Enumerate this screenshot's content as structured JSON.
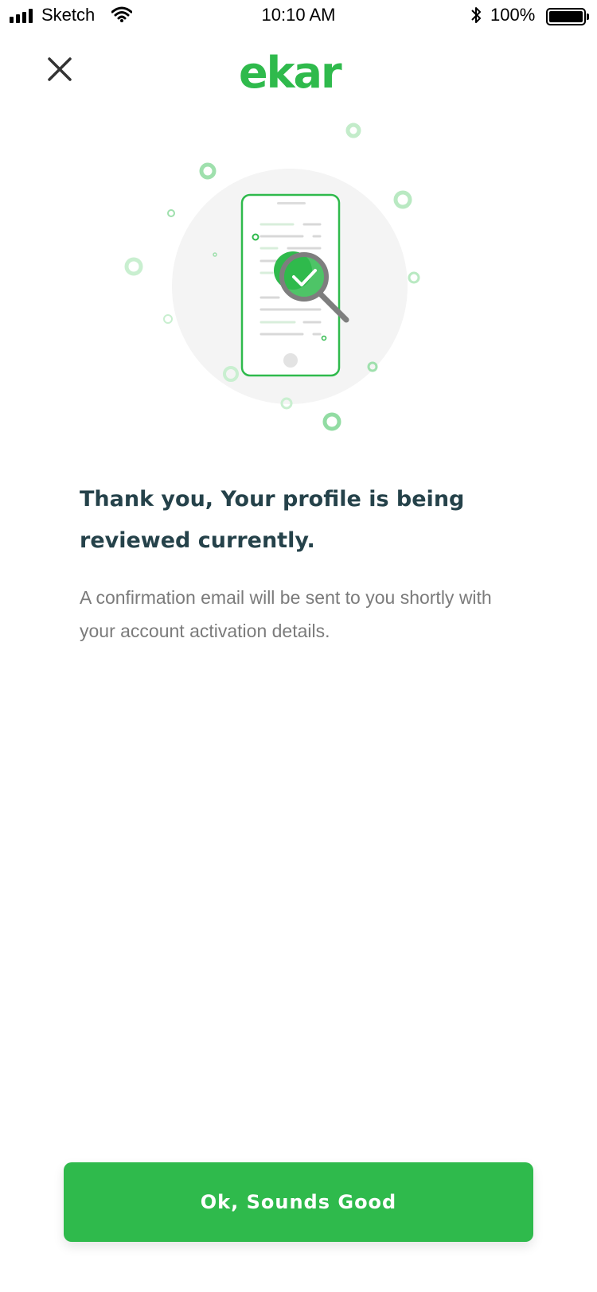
{
  "status_bar": {
    "carrier": "Sketch",
    "time": "10:10 AM",
    "battery_percent": "100%",
    "icons": [
      "signal-icon",
      "wifi-icon",
      "bluetooth-icon",
      "battery-icon"
    ]
  },
  "header": {
    "close_icon": "close-icon",
    "logo_text": "ekar"
  },
  "main": {
    "illustration_icon": "phone-check-magnifier-icon",
    "headline": "Thank you, Your profile is being reviewed currently.",
    "body": "A confirmation email will be sent to you shortly with your account activation details."
  },
  "cta": {
    "label": "Ok, Sounds Good"
  },
  "colors": {
    "brand_green": "#2fba4c",
    "headline": "#25424a",
    "body_text": "#7b7b7b",
    "accent_light_green": "#a8e6b4"
  }
}
